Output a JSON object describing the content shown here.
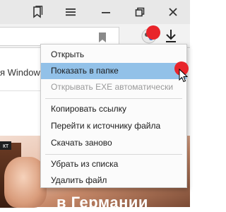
{
  "window": {
    "buttons": [
      {
        "name": "bookmarks-panel",
        "icon": "bookmarks-icon"
      },
      {
        "name": "menu",
        "icon": "hamburger-icon"
      },
      {
        "name": "minimize",
        "icon": "minimize-icon"
      },
      {
        "name": "restore",
        "icon": "restore-icon"
      },
      {
        "name": "close",
        "icon": "close-icon"
      }
    ]
  },
  "toolbar": {
    "bookmark_icon": "bookmark-icon",
    "profile_icon": "profile-icon",
    "download_icon": "download-icon"
  },
  "page": {
    "text_fragment": "я Window",
    "photo_label": "кт",
    "photo_caption": "в Германии"
  },
  "context_menu": {
    "items": [
      {
        "label": "Открыть",
        "state": "normal"
      },
      {
        "label": "Показать в папке",
        "state": "highlighted"
      },
      {
        "label": "Открывать EXE автоматически",
        "state": "disabled"
      },
      {
        "label": "Копировать ссылку",
        "state": "normal"
      },
      {
        "label": "Перейти к источнику файла",
        "state": "normal"
      },
      {
        "label": "Скачать заново",
        "state": "normal"
      },
      {
        "label": "Убрать из списка",
        "state": "normal"
      },
      {
        "label": "Удалить файл",
        "state": "normal"
      }
    ]
  },
  "colors": {
    "highlight": "#92c1e8",
    "annotation_dot": "#e8242a",
    "disabled_text": "#9a9a9a"
  }
}
